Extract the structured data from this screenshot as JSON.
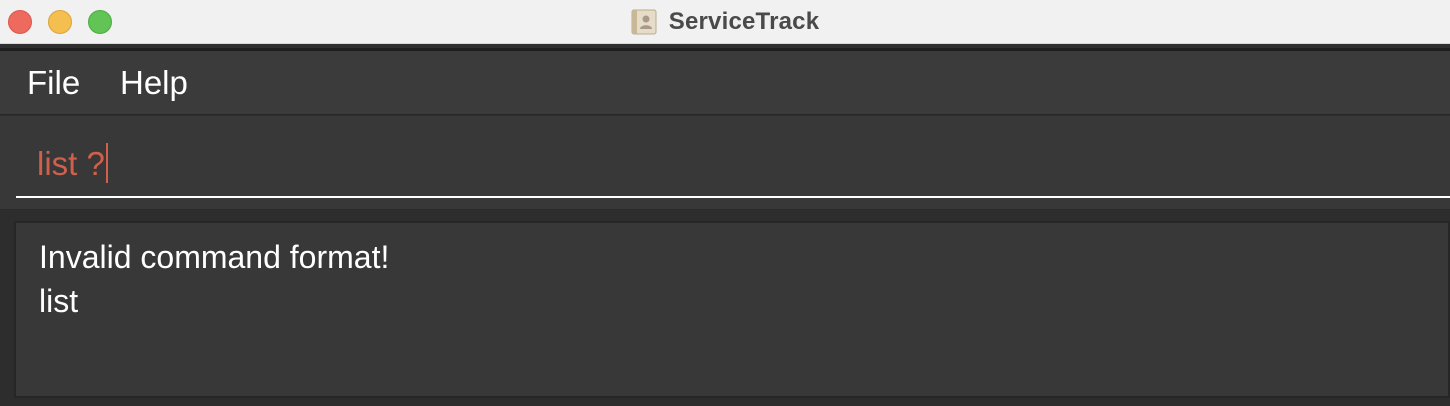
{
  "window": {
    "title": "ServiceTrack",
    "app_icon": "address-book-icon",
    "controls": [
      "close",
      "minimize",
      "zoom"
    ],
    "colors": {
      "close": "#ee6a5e",
      "minimize": "#f5bf4f",
      "zoom": "#61c454"
    }
  },
  "menubar": {
    "items": [
      {
        "label": "File"
      },
      {
        "label": "Help"
      }
    ]
  },
  "command": {
    "value": "list ?",
    "text_color": "#d0604b"
  },
  "result": {
    "lines": [
      "Invalid command format!",
      "list"
    ]
  }
}
